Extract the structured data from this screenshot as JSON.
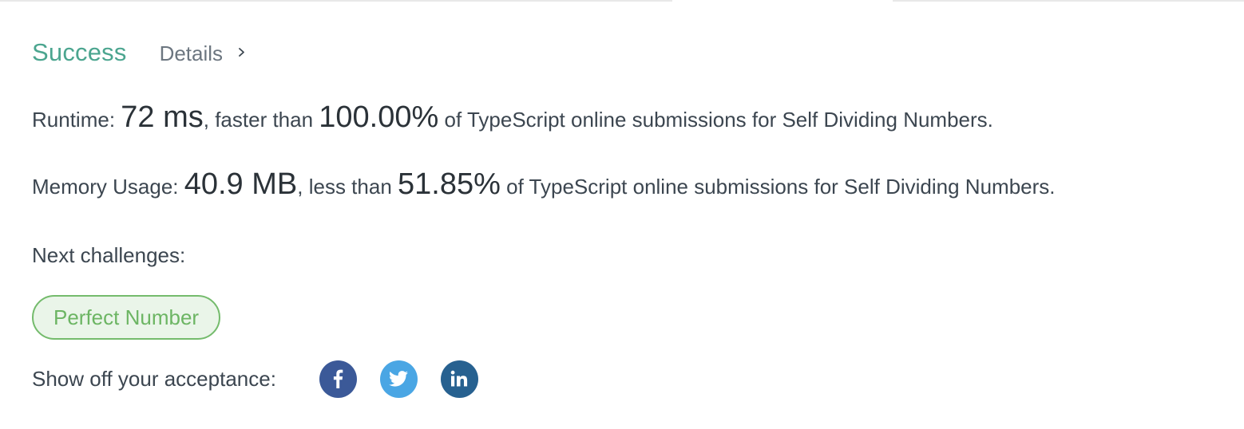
{
  "result": {
    "status": "Success",
    "details_label": "Details"
  },
  "runtime": {
    "label": "Runtime: ",
    "value": "72 ms",
    "comparison": ", faster than ",
    "percent": "100.00%",
    "suffix": " of TypeScript online submissions for Self Dividing Numbers."
  },
  "memory": {
    "label": "Memory Usage: ",
    "value": "40.9 MB",
    "comparison": ", less than ",
    "percent": "51.85%",
    "suffix": " of TypeScript online submissions for Self Dividing Numbers."
  },
  "next_challenges": {
    "label": "Next challenges:",
    "items": [
      {
        "label": "Perfect Number"
      }
    ]
  },
  "share": {
    "label": "Show off your acceptance:",
    "icons": [
      "facebook-icon",
      "twitter-icon",
      "linkedin-icon"
    ]
  },
  "colors": {
    "success": "#4ba58f",
    "tag_border": "#74bb6c",
    "tag_bg": "#eaf5e9",
    "facebook": "#3b5998",
    "twitter": "#4aa6e4",
    "linkedin": "#276190"
  }
}
